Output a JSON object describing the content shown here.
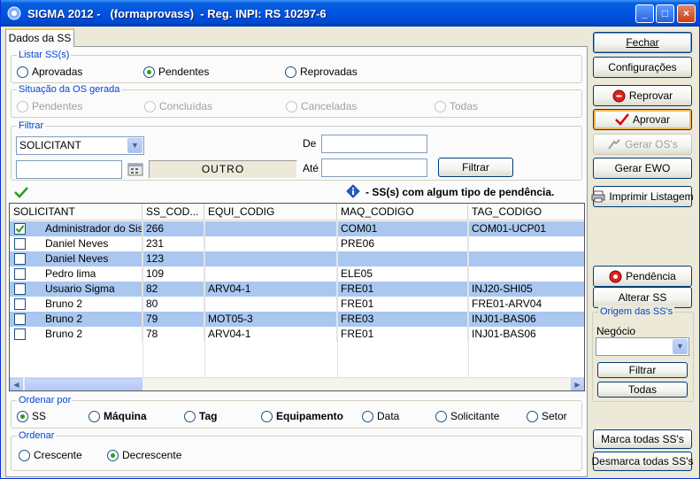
{
  "window": {
    "title": "SIGMA 2012 -   (formaprovass)  - Reg. INPI: RS 10297-6",
    "minimize": "_",
    "maximize": "□",
    "close": "×"
  },
  "tab": {
    "label": "Dados da SS"
  },
  "listar": {
    "legend": "Listar SS(s)",
    "options": [
      "Aprovadas",
      "Pendentes",
      "Reprovadas"
    ],
    "selected": "Pendentes"
  },
  "situacao": {
    "legend": "Situação da OS gerada",
    "options": [
      "Pendentes",
      "Concluídas",
      "Canceladas",
      "Todas"
    ]
  },
  "filtrar": {
    "legend": "Filtrar",
    "field_select": "SOLICITANT",
    "text_value": "",
    "outro_label": "OUTRO",
    "de_label": "De",
    "ate_label": "Até",
    "de_value": "",
    "ate_value": "",
    "button": "Filtrar"
  },
  "pendencia_note": "- SS(s) com algum tipo de pendência.",
  "grid": {
    "columns": [
      "SOLICITANT",
      "SS_COD...",
      "EQUI_CODIG",
      "MAQ_CODIGO",
      "TAG_CODIGO"
    ],
    "rows": [
      {
        "checked": true,
        "solicitant": "Administrador do Sist...",
        "ss": "266",
        "equi": "",
        "maq": "COM01",
        "tag": "COM01-UCP01"
      },
      {
        "checked": false,
        "solicitant": "Daniel Neves",
        "ss": "231",
        "equi": "",
        "maq": "PRE06",
        "tag": ""
      },
      {
        "checked": false,
        "solicitant": "Daniel Neves",
        "ss": "123",
        "equi": "",
        "maq": "",
        "tag": ""
      },
      {
        "checked": false,
        "solicitant": "Pedro lima",
        "ss": "109",
        "equi": "",
        "maq": "ELE05",
        "tag": ""
      },
      {
        "checked": false,
        "solicitant": "Usuario Sigma",
        "ss": "82",
        "equi": "ARV04-1",
        "maq": "FRE01",
        "tag": "INJ20-SHI05"
      },
      {
        "checked": false,
        "solicitant": "Bruno 2",
        "ss": "80",
        "equi": "",
        "maq": "FRE01",
        "tag": "FRE01-ARV04"
      },
      {
        "checked": false,
        "solicitant": "Bruno 2",
        "ss": "79",
        "equi": "MOT05-3",
        "maq": "FRE03",
        "tag": "INJ01-BAS06"
      },
      {
        "checked": false,
        "solicitant": "Bruno 2",
        "ss": "78",
        "equi": "ARV04-1",
        "maq": "FRE01",
        "tag": "INJ01-BAS06"
      }
    ]
  },
  "ordenar_por": {
    "legend": "Ordenar por",
    "options": [
      "SS",
      "Máquina",
      "Tag",
      "Equipamento",
      "Data",
      "Solicitante",
      "Setor"
    ],
    "selected": "SS"
  },
  "ordenar": {
    "legend": "Ordenar",
    "options": [
      "Crescente",
      "Decrescente"
    ],
    "selected": "Decrescente"
  },
  "sidebar": {
    "fechar": "Fechar",
    "configuracoes": "Configurações",
    "reprovar": "Reprovar",
    "aprovar": "Aprovar",
    "gerar_os": "Gerar OS's",
    "gerar_ewo": "Gerar EWO",
    "imprimir": "Imprimir Listagem",
    "pendencia": "Pendência",
    "alterar_ss": "Alterar SS",
    "origem": {
      "legend": "Origem das SS's",
      "negocio_label": "Negócio",
      "negocio_value": "",
      "filtrar": "Filtrar",
      "todas": "Todas"
    },
    "marca_todas": "Marca todas SS's",
    "desmarca_todas": "Desmarca todas SS's"
  },
  "colors": {
    "titlebar": "#0054e3",
    "row_highlight": "#a9c7ef",
    "legend_text": "#0046d5",
    "check_green": "#21a121"
  }
}
